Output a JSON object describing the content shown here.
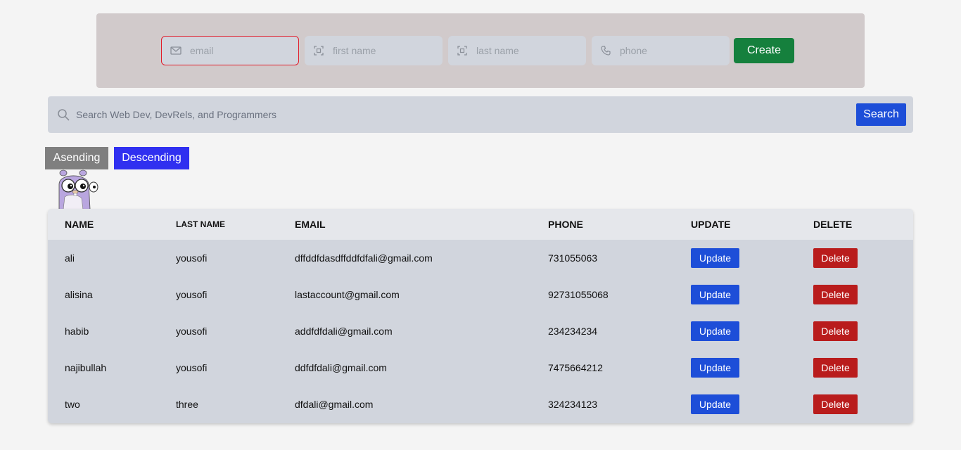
{
  "create_form": {
    "email": {
      "placeholder": "email",
      "value": "",
      "icon": "mail-icon"
    },
    "first_name": {
      "placeholder": "first name",
      "value": "",
      "icon": "id-card-icon"
    },
    "last_name": {
      "placeholder": "last name",
      "value": "",
      "icon": "id-card-icon"
    },
    "phone": {
      "placeholder": "phone",
      "value": "",
      "icon": "phone-icon"
    },
    "create_label": "Create"
  },
  "search": {
    "placeholder": "Search Web Dev, DevRels, and Programmers",
    "value": "",
    "button_label": "Search"
  },
  "sort": {
    "ascending_label": "Asending",
    "descending_label": "Descending"
  },
  "table": {
    "headers": [
      "NAME",
      "LAST NAME",
      "EMAIL",
      "PHONE",
      "UPDATE",
      "DELETE"
    ],
    "rows": [
      {
        "name": "ali",
        "last_name": "yousofi",
        "email": "dffddfdasdffddfdfali@gmail.com",
        "phone": "731055063",
        "update": "Update",
        "delete": "Delete"
      },
      {
        "name": "alisina",
        "last_name": "yousofi",
        "email": "lastaccount@gmail.com",
        "phone": "92731055068",
        "update": "Update",
        "delete": "Delete"
      },
      {
        "name": "habib",
        "last_name": "yousofi",
        "email": "addfdfdali@gmail.com",
        "phone": "234234234",
        "update": "Update",
        "delete": "Delete"
      },
      {
        "name": "najibullah",
        "last_name": "yousofi",
        "email": "ddfdfdali@gmail.com",
        "phone": "7475664212",
        "update": "Update",
        "delete": "Delete"
      },
      {
        "name": "two",
        "last_name": "three",
        "email": "dfdali@gmail.com",
        "phone": "324234123",
        "update": "Update",
        "delete": "Delete"
      }
    ]
  },
  "colors": {
    "create": "#15803d",
    "primary": "#1d4ed8",
    "danger": "#b91c1c",
    "descending": "#3030f0",
    "ascending": "#7f7f7f",
    "focus_border": "#e11d2a"
  }
}
